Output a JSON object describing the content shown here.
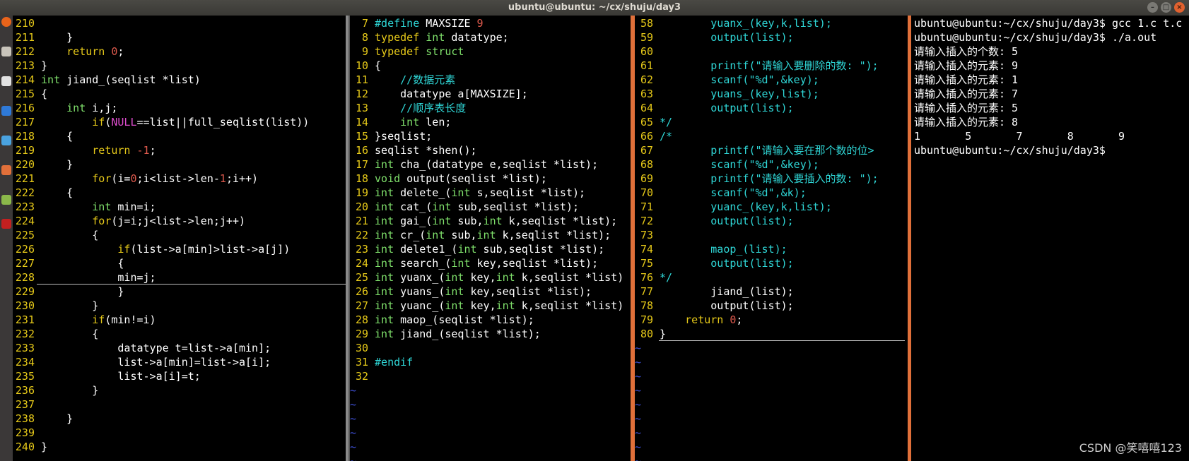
{
  "window": {
    "title": "ubuntu@ubuntu: ~/cx/shuju/day3",
    "buttons": [
      "–",
      "□",
      "×"
    ]
  },
  "watermark": "CSDN @笑嘻嘻123",
  "pane1": {
    "lines": [
      {
        "n": "210",
        "seg": []
      },
      {
        "n": "211",
        "seg": [
          [
            "c",
            "    }"
          ]
        ]
      },
      {
        "n": "212",
        "seg": [
          [
            "c",
            "    "
          ],
          [
            "k",
            "return"
          ],
          [
            "c",
            " "
          ],
          [
            "n",
            "0"
          ],
          [
            "c",
            ";"
          ]
        ]
      },
      {
        "n": "213",
        "seg": [
          [
            "c",
            "}"
          ]
        ]
      },
      {
        "n": "214",
        "seg": [
          [
            "t",
            "int"
          ],
          [
            "c",
            " jiand_(seqlist *list)"
          ]
        ]
      },
      {
        "n": "215",
        "seg": [
          [
            "c",
            "{"
          ]
        ]
      },
      {
        "n": "216",
        "seg": [
          [
            "c",
            "    "
          ],
          [
            "t",
            "int"
          ],
          [
            "c",
            " i,j;"
          ]
        ]
      },
      {
        "n": "217",
        "seg": [
          [
            "c",
            "        "
          ],
          [
            "k",
            "if"
          ],
          [
            "c",
            "("
          ],
          [
            "s",
            "NULL"
          ],
          [
            "c",
            "==list||full_seqlist(list))"
          ]
        ]
      },
      {
        "n": "218",
        "seg": [
          [
            "c",
            "    {"
          ]
        ]
      },
      {
        "n": "219",
        "seg": [
          [
            "c",
            "        "
          ],
          [
            "k",
            "return"
          ],
          [
            "c",
            " "
          ],
          [
            "n",
            "-1"
          ],
          [
            "c",
            ";"
          ]
        ]
      },
      {
        "n": "220",
        "seg": [
          [
            "c",
            "    }"
          ]
        ]
      },
      {
        "n": "221",
        "seg": [
          [
            "c",
            "        "
          ],
          [
            "k",
            "for"
          ],
          [
            "c",
            "(i="
          ],
          [
            "n",
            "0"
          ],
          [
            "c",
            ";i<list->len-"
          ],
          [
            "n",
            "1"
          ],
          [
            "c",
            ";i++)"
          ]
        ]
      },
      {
        "n": "222",
        "seg": [
          [
            "c",
            "    {"
          ]
        ]
      },
      {
        "n": "223",
        "seg": [
          [
            "c",
            "        "
          ],
          [
            "t",
            "int"
          ],
          [
            "c",
            " min=i;"
          ]
        ]
      },
      {
        "n": "224",
        "seg": [
          [
            "c",
            "        "
          ],
          [
            "k",
            "for"
          ],
          [
            "c",
            "(j=i;j<list->len;j++)"
          ]
        ]
      },
      {
        "n": "225",
        "seg": [
          [
            "c",
            "        {"
          ]
        ]
      },
      {
        "n": "226",
        "seg": [
          [
            "c",
            "            "
          ],
          [
            "k",
            "if"
          ],
          [
            "c",
            "(list->a[min]>list->a[j])"
          ]
        ]
      },
      {
        "n": "227",
        "seg": [
          [
            "c",
            "            {"
          ]
        ]
      },
      {
        "n": "228",
        "seg": [
          [
            "c",
            "            min=j;"
          ]
        ]
      },
      {
        "n": "229",
        "seg": [
          [
            "c",
            "            }"
          ]
        ]
      },
      {
        "n": "230",
        "seg": [
          [
            "c",
            "        }"
          ]
        ]
      },
      {
        "n": "231",
        "seg": [
          [
            "c",
            "        "
          ],
          [
            "k",
            "if"
          ],
          [
            "c",
            "(min!=i)"
          ]
        ]
      },
      {
        "n": "232",
        "seg": [
          [
            "c",
            "        {"
          ]
        ]
      },
      {
        "n": "233",
        "seg": [
          [
            "c",
            "            datatype t=list->a[min];"
          ]
        ]
      },
      {
        "n": "234",
        "seg": [
          [
            "c",
            "            list->a[min]=list->a[i];"
          ]
        ]
      },
      {
        "n": "235",
        "seg": [
          [
            "c",
            "            list->a[i]=t;"
          ]
        ]
      },
      {
        "n": "236",
        "seg": [
          [
            "c",
            "        }"
          ]
        ]
      },
      {
        "n": "237",
        "seg": []
      },
      {
        "n": "238",
        "seg": [
          [
            "c",
            "    }"
          ]
        ]
      },
      {
        "n": "239",
        "seg": []
      },
      {
        "n": "240",
        "seg": [
          [
            "c",
            "}"
          ]
        ]
      }
    ]
  },
  "pane2": {
    "lines": [
      {
        "n": "7",
        "seg": [
          [
            "p",
            "#define"
          ],
          [
            "c",
            " MAXSIZE "
          ],
          [
            "n",
            "9"
          ]
        ]
      },
      {
        "n": "8",
        "seg": [
          [
            "k",
            "typedef"
          ],
          [
            "c",
            " "
          ],
          [
            "t",
            "int"
          ],
          [
            "c",
            " datatype;"
          ]
        ]
      },
      {
        "n": "9",
        "seg": [
          [
            "k",
            "typedef"
          ],
          [
            "c",
            " "
          ],
          [
            "t",
            "struct"
          ]
        ]
      },
      {
        "n": "10",
        "seg": [
          [
            "c",
            "{"
          ]
        ]
      },
      {
        "n": "11",
        "seg": [
          [
            "c",
            "    "
          ],
          [
            "cm",
            "//数据元素"
          ]
        ]
      },
      {
        "n": "12",
        "seg": [
          [
            "c",
            "    datatype a[MAXSIZE];"
          ]
        ]
      },
      {
        "n": "13",
        "seg": [
          [
            "c",
            "    "
          ],
          [
            "cm",
            "//顺序表长度"
          ]
        ]
      },
      {
        "n": "14",
        "seg": [
          [
            "c",
            "    "
          ],
          [
            "t",
            "int"
          ],
          [
            "c",
            " len;"
          ]
        ]
      },
      {
        "n": "15",
        "seg": [
          [
            "c",
            "}seqlist;"
          ]
        ]
      },
      {
        "n": "16",
        "seg": [
          [
            "c",
            "seqlist *shen();"
          ]
        ]
      },
      {
        "n": "17",
        "seg": [
          [
            "t",
            "int"
          ],
          [
            "c",
            " cha_(datatype e,seqlist *list);"
          ]
        ]
      },
      {
        "n": "18",
        "seg": [
          [
            "t",
            "void"
          ],
          [
            "c",
            " output(seqlist *list);"
          ]
        ]
      },
      {
        "n": "19",
        "seg": [
          [
            "t",
            "int"
          ],
          [
            "c",
            " delete_("
          ],
          [
            "t",
            "int"
          ],
          [
            "c",
            " s,seqlist *list);"
          ]
        ]
      },
      {
        "n": "20",
        "seg": [
          [
            "t",
            "int"
          ],
          [
            "c",
            " cat_("
          ],
          [
            "t",
            "int"
          ],
          [
            "c",
            " sub,seqlist *list);"
          ]
        ]
      },
      {
        "n": "21",
        "seg": [
          [
            "t",
            "int"
          ],
          [
            "c",
            " gai_("
          ],
          [
            "t",
            "int"
          ],
          [
            "c",
            " sub,"
          ],
          [
            "t",
            "int"
          ],
          [
            "c",
            " k,seqlist *list);"
          ]
        ]
      },
      {
        "n": "22",
        "seg": [
          [
            "t",
            "int"
          ],
          [
            "c",
            " cr_("
          ],
          [
            "t",
            "int"
          ],
          [
            "c",
            " sub,"
          ],
          [
            "t",
            "int"
          ],
          [
            "c",
            " k,seqlist *list);"
          ]
        ]
      },
      {
        "n": "23",
        "seg": [
          [
            "t",
            "int"
          ],
          [
            "c",
            " delete1_("
          ],
          [
            "t",
            "int"
          ],
          [
            "c",
            " sub,seqlist *list);"
          ]
        ]
      },
      {
        "n": "24",
        "seg": [
          [
            "t",
            "int"
          ],
          [
            "c",
            " search_("
          ],
          [
            "t",
            "int"
          ],
          [
            "c",
            " key,seqlist *list);"
          ]
        ]
      },
      {
        "n": "25",
        "seg": [
          [
            "t",
            "int"
          ],
          [
            "c",
            " yuanx_("
          ],
          [
            "t",
            "int"
          ],
          [
            "c",
            " key,"
          ],
          [
            "t",
            "int"
          ],
          [
            "c",
            " k,seqlist *list)"
          ]
        ]
      },
      {
        "n": "26",
        "seg": [
          [
            "t",
            "int"
          ],
          [
            "c",
            " yuans_("
          ],
          [
            "t",
            "int"
          ],
          [
            "c",
            " key,seqlist *list);"
          ]
        ]
      },
      {
        "n": "27",
        "u": true,
        "seg": [
          [
            "t",
            "int"
          ],
          [
            "c",
            " yuanc_("
          ],
          [
            "t",
            "int"
          ],
          [
            "c",
            " key,"
          ],
          [
            "t",
            "int"
          ],
          [
            "c",
            " k,seqlist *list)"
          ]
        ]
      },
      {
        "n": "28",
        "seg": [
          [
            "t",
            "int"
          ],
          [
            "c",
            " maop_(seqlist *list);"
          ]
        ]
      },
      {
        "n": "29",
        "seg": [
          [
            "t",
            "int"
          ],
          [
            "c",
            " jiand_(seqlist *list);"
          ]
        ]
      },
      {
        "n": "30",
        "seg": []
      },
      {
        "n": "31",
        "seg": [
          [
            "p",
            "#endif"
          ]
        ]
      },
      {
        "n": "32",
        "seg": []
      }
    ],
    "tildes": 7
  },
  "pane3": {
    "lines": [
      {
        "n": "58",
        "seg": [
          [
            "cm",
            "        yuanx_(key,k,list);"
          ]
        ]
      },
      {
        "n": "59",
        "seg": [
          [
            "cm",
            "        output(list);"
          ]
        ]
      },
      {
        "n": "60",
        "seg": []
      },
      {
        "n": "61",
        "seg": [
          [
            "cm",
            "        printf(\"请输入要删除的数: \");"
          ]
        ]
      },
      {
        "n": "62",
        "seg": [
          [
            "cm",
            "        scanf(\"%d\",&key);"
          ]
        ]
      },
      {
        "n": "63",
        "seg": [
          [
            "cm",
            "        yuans_(key,list);"
          ]
        ]
      },
      {
        "n": "64",
        "seg": [
          [
            "cm",
            "        output(list);"
          ]
        ]
      },
      {
        "n": "65",
        "seg": [
          [
            "cm",
            "*/"
          ]
        ]
      },
      {
        "n": "66",
        "seg": [
          [
            "cm",
            "/*"
          ]
        ]
      },
      {
        "n": "67",
        "seg": [
          [
            "cm",
            "        printf(\"请输入要在那个数的位>"
          ]
        ]
      },
      {
        "n": "68",
        "seg": [
          [
            "cm",
            "        scanf(\"%d\",&key);"
          ]
        ]
      },
      {
        "n": "69",
        "seg": [
          [
            "cm",
            "        printf(\"请输入要插入的数: \");"
          ]
        ]
      },
      {
        "n": "70",
        "seg": [
          [
            "cm",
            "        scanf(\"%d\",&k);"
          ]
        ]
      },
      {
        "n": "71",
        "seg": [
          [
            "cm",
            "        yuanc_(key,k,list);"
          ]
        ]
      },
      {
        "n": "72",
        "seg": [
          [
            "cm",
            "        output(list);"
          ]
        ]
      },
      {
        "n": "73",
        "seg": []
      },
      {
        "n": "74",
        "seg": [
          [
            "cm",
            "        maop_(list);"
          ]
        ]
      },
      {
        "n": "75",
        "seg": [
          [
            "cm",
            "        output(list);"
          ]
        ]
      },
      {
        "n": "76",
        "seg": [
          [
            "cm",
            "*/"
          ]
        ]
      },
      {
        "n": "77",
        "seg": [
          [
            "c",
            "        jiand_(list);"
          ]
        ]
      },
      {
        "n": "78",
        "seg": [
          [
            "c",
            "        output(list);"
          ]
        ]
      },
      {
        "n": "79",
        "seg": [
          [
            "c",
            "    "
          ],
          [
            "k",
            "return"
          ],
          [
            "c",
            " "
          ],
          [
            "n",
            "0"
          ],
          [
            "c",
            ";"
          ]
        ]
      },
      {
        "n": "80",
        "seg": [
          [
            "c",
            "}"
          ]
        ]
      }
    ],
    "tildes": 9
  },
  "terminal": {
    "lines": [
      "ubuntu@ubuntu:~/cx/shuju/day3$ gcc 1.c t.c",
      "ubuntu@ubuntu:~/cx/shuju/day3$ ./a.out",
      "请输入插入的个数: 5",
      "请输入插入的元素: 9",
      "请输入插入的元素: 1",
      "请输入插入的元素: 7",
      "请输入插入的元素: 5",
      "请输入插入的元素: 8",
      "1       5       7       8       9",
      "ubuntu@ubuntu:~/cx/shuju/day3$"
    ]
  }
}
